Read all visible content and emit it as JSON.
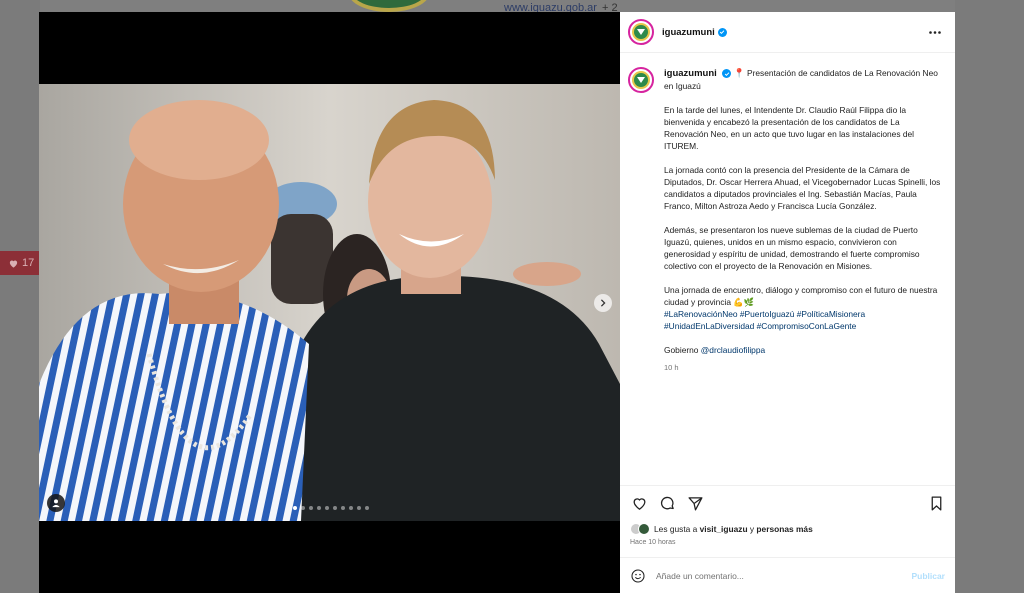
{
  "background": {
    "link_text": "www.iguazu.gob.ar",
    "link_suffix": "+ 2",
    "like_count": "17"
  },
  "post": {
    "username": "iguazumuni",
    "verified": true,
    "caption_title": "Presentación de candidatos de La Renovación Neo en Iguazú",
    "paragraphs": [
      "En la tarde del lunes, el Intendente Dr. Claudio Raúl Filippa dio la bienvenida y encabezó la presentación de los candidatos de La Renovación Neo, en un acto que tuvo lugar en las instalaciones del ITUREM.",
      "La jornada contó con la presencia del Presidente de la Cámara de Diputados, Dr. Oscar Herrera Ahuad, el Vicegobernador Lucas Spinelli, los candidatos a diputados provinciales el Ing. Sebastián Macías, Paula Franco, Milton Astroza Aedo y Francisca Lucía González.",
      "Además, se presentaron los nueve sublemas de la ciudad de Puerto Iguazú, quienes, unidos en un mismo espacio, convivieron con generosidad y espíritu de unidad, demostrando el fuerte compromiso colectivo con el proyecto de la Renovación en Misiones."
    ],
    "closing_line": "Una jornada de encuentro, diálogo y compromiso con el futuro de nuestra ciudad y provincia 💪🌿",
    "hashtags": "#LaRenovaciónNeo #PuertoIguazú #PolíticaMisionera #UnidadEnLaDiversidad #CompromisoConLaGente",
    "gobierno_label": "Gobierno",
    "gobierno_mention": "@drclaudiofilippa",
    "time": "10 h",
    "likes_prefix": "Les gusta a",
    "likes_user": "visit_iguazu",
    "likes_connector": "y",
    "likes_others": "personas más",
    "posted_ago": "Hace 10 horas",
    "comment_placeholder": "Añade un comentario...",
    "publish_label": "Publicar",
    "carousel_count": 10,
    "carousel_active": 0
  },
  "colors": {
    "verified": "#0095f6",
    "link": "#00376b",
    "publish_disabled": "#b2dffc"
  }
}
